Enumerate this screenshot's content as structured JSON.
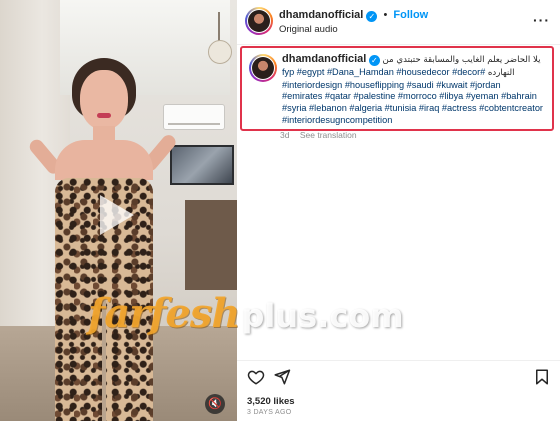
{
  "post": {
    "username": "dhamdanofficial",
    "dot": "•",
    "follow_label": "Follow",
    "audio_label": "Original audio",
    "more_label": "···"
  },
  "caption": {
    "username": "dhamdanofficial",
    "arabic_head": "يلا الحاضر يعلم الغايب والمسابقة حتبتدي من",
    "line2_tags": "fyp #egypt #Dana_Hamdan #housedecor #decor#",
    "line2_arabic": "النهارده",
    "line3": "#interiordesign #houseflipping #saudi #kuwait #jordan",
    "line4": "#emirates #qatar #palestine #morroco #libya #yeman #bahrain",
    "line5": "#syria #lebanon #algeria #tunisia #iraq #actress #cobtentcreator",
    "line6": "#interiordesugncompetition",
    "age": "3d",
    "see_translation": "See translation"
  },
  "video": {
    "play_icon": "play-icon",
    "mute_symbol": "🔇"
  },
  "watermark": {
    "part1": "farfesh",
    "part2": "plus.com"
  },
  "actions": {
    "likes": "3,520 likes",
    "date": "3 DAYS AGO"
  },
  "colors": {
    "accent": "#0095f6",
    "highlight_border": "#e0334b",
    "hashtag": "#00376b",
    "watermark_orange": "#f3a62e"
  }
}
